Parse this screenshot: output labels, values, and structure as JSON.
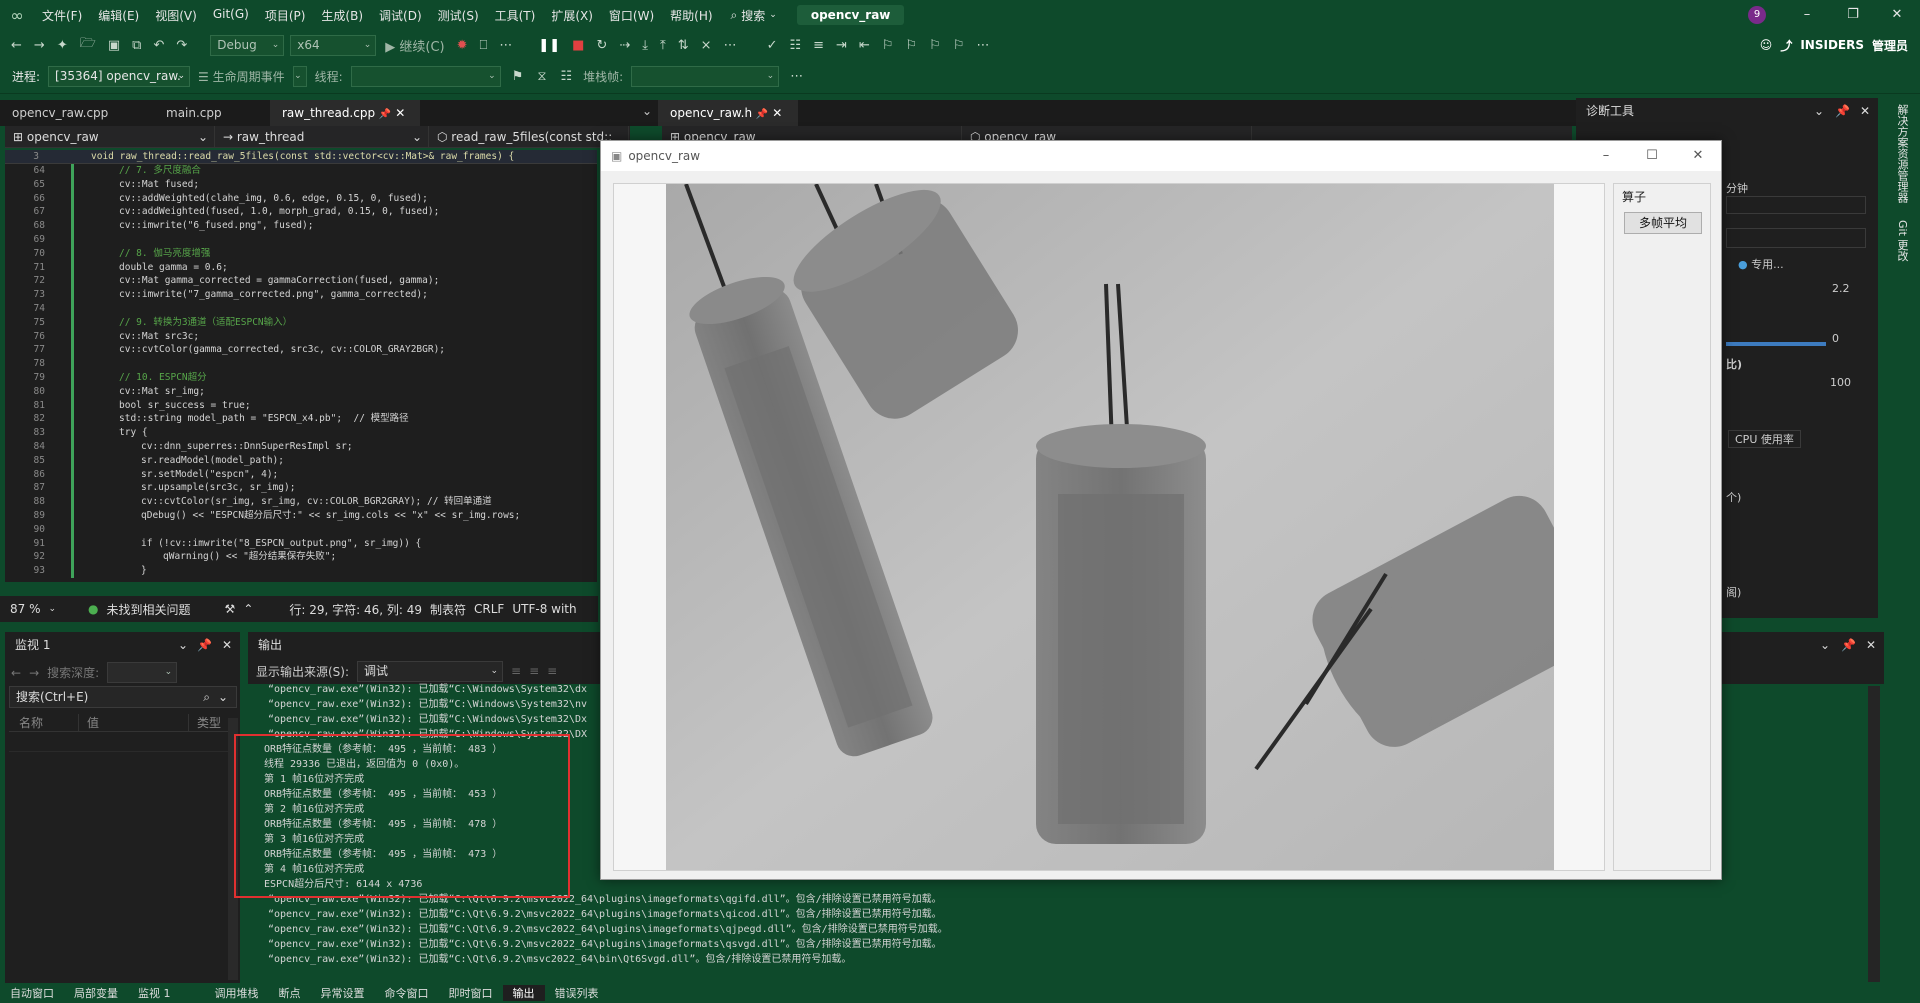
{
  "menubar": {
    "items": [
      "文件(F)",
      "编辑(E)",
      "视图(V)",
      "Git(G)",
      "项目(P)",
      "生成(B)",
      "调试(D)",
      "测试(S)",
      "工具(T)",
      "扩展(X)",
      "窗口(W)",
      "帮助(H)"
    ],
    "search_label": "搜索",
    "solution_name": "opencv_raw",
    "notification_count": "9"
  },
  "toolbar1": {
    "config": "Debug",
    "platform": "x64",
    "continue_label": "继续(C)",
    "insiders_label": "INSIDERS",
    "admin_label": "管理员"
  },
  "toolbar2": {
    "process_label": "进程:",
    "process_value": "[35364] opencv_raw.",
    "lifecycle_label": "生命周期事件",
    "thread_label": "线程:",
    "stackframe_label": "堆栈帧:"
  },
  "editor": {
    "tabs": [
      "opencv_raw.cpp",
      "main.cpp",
      "raw_thread.cpp"
    ],
    "active_tab": "raw_thread.cpp",
    "nav_project": "opencv_raw",
    "nav_scope": "raw_thread",
    "nav_member": "read_raw_5files(const std::",
    "sticky_line_number": "3",
    "sticky_line": "void raw_thread::read_raw_5files(const std::vector<cv::Mat>& raw_frames) {",
    "lines": [
      {
        "n": "64",
        "t": "// 7. 多尺度融合",
        "k": "com",
        "i": 1
      },
      {
        "n": "65",
        "t": "cv::Mat fused;",
        "k": "code",
        "i": 1
      },
      {
        "n": "66",
        "t": "cv::addWeighted(clahe_img, 0.6, edge, 0.15, 0, fused);",
        "k": "code",
        "i": 1
      },
      {
        "n": "67",
        "t": "cv::addWeighted(fused, 1.0, morph_grad, 0.15, 0, fused);",
        "k": "code",
        "i": 1
      },
      {
        "n": "68",
        "t": "cv::imwrite(\"6_fused.png\", fused);",
        "k": "code",
        "i": 1
      },
      {
        "n": "69",
        "t": "",
        "k": "code",
        "i": 1
      },
      {
        "n": "70",
        "t": "// 8. 伽马亮度增强",
        "k": "com",
        "i": 1
      },
      {
        "n": "71",
        "t": "double gamma = 0.6;",
        "k": "code",
        "i": 1
      },
      {
        "n": "72",
        "t": "cv::Mat gamma_corrected = gammaCorrection(fused, gamma);",
        "k": "code",
        "i": 1
      },
      {
        "n": "73",
        "t": "cv::imwrite(\"7_gamma_corrected.png\", gamma_corrected);",
        "k": "code",
        "i": 1
      },
      {
        "n": "74",
        "t": "",
        "k": "code",
        "i": 1
      },
      {
        "n": "75",
        "t": "// 9. 转换为3通道（适配ESPCN输入）",
        "k": "com",
        "i": 1
      },
      {
        "n": "76",
        "t": "cv::Mat src3c;",
        "k": "code",
        "i": 1
      },
      {
        "n": "77",
        "t": "cv::cvtColor(gamma_corrected, src3c, cv::COLOR_GRAY2BGR);",
        "k": "code",
        "i": 1
      },
      {
        "n": "78",
        "t": "",
        "k": "code",
        "i": 1
      },
      {
        "n": "79",
        "t": "// 10. ESPCN超分",
        "k": "com",
        "i": 1
      },
      {
        "n": "80",
        "t": "cv::Mat sr_img;",
        "k": "code",
        "i": 1
      },
      {
        "n": "81",
        "t": "bool sr_success = true;",
        "k": "code",
        "i": 1
      },
      {
        "n": "82",
        "t": "std::string model_path = \"ESPCN_x4.pb\";  // 模型路径",
        "k": "code",
        "i": 1
      },
      {
        "n": "83",
        "t": "try {",
        "k": "code",
        "i": 1
      },
      {
        "n": "84",
        "t": "cv::dnn_superres::DnnSuperResImpl sr;",
        "k": "code",
        "i": 2
      },
      {
        "n": "85",
        "t": "sr.readModel(model_path);",
        "k": "code",
        "i": 2
      },
      {
        "n": "86",
        "t": "sr.setModel(\"espcn\", 4);",
        "k": "code",
        "i": 2
      },
      {
        "n": "87",
        "t": "sr.upsample(src3c, sr_img);",
        "k": "code",
        "i": 2
      },
      {
        "n": "88",
        "t": "cv::cvtColor(sr_img, sr_img, cv::COLOR_BGR2GRAY); // 转回单通道",
        "k": "code",
        "i": 2
      },
      {
        "n": "89",
        "t": "qDebug() << \"ESPCN超分后尺寸:\" << sr_img.cols << \"x\" << sr_img.rows;",
        "k": "code",
        "i": 2
      },
      {
        "n": "90",
        "t": "",
        "k": "code",
        "i": 2
      },
      {
        "n": "91",
        "t": "if (!cv::imwrite(\"8_ESPCN_output.png\", sr_img)) {",
        "k": "code",
        "i": 2
      },
      {
        "n": "92",
        "t": "qWarning() << \"超分结果保存失败\";",
        "k": "code",
        "i": 3
      },
      {
        "n": "93",
        "t": "}",
        "k": "code",
        "i": 2
      }
    ],
    "zoom": "87 %",
    "issues": "未找到相关问题",
    "position": "行: 29, 字符: 46, 列: 49",
    "indent": "制表符",
    "eol": "CRLF",
    "encoding": "UTF-8 with"
  },
  "editor2": {
    "tab": "opencv_raw.h",
    "nav_project": "opencv_raw",
    "nav_scope": "opencv_raw"
  },
  "watch": {
    "title": "监视 1",
    "search_depth_label": "搜索深度:",
    "search_placeholder": "搜索(Ctrl+E)",
    "col_name": "名称",
    "col_value": "值",
    "col_type": "类型"
  },
  "output": {
    "title": "输出",
    "source_label": "显示输出来源(S):",
    "source_value": "调试",
    "lines": [
      "“opencv_raw.exe”(Win32): 已加载“C:\\Windows\\System32\\dx",
      "“opencv_raw.exe”(Win32): 已加载“C:\\Windows\\System32\\nv",
      "“opencv_raw.exe”(Win32): 已加载“C:\\Windows\\System32\\Dx",
      "“opencv_raw.exe”(Win32): 已加载“C:\\Windows\\System32\\DX",
      "ORB特征点数量（参考帧： 495 ，当前帧： 483 ）",
      "线程 29336 已退出，返回值为 0 (0x0)。",
      "第 1 帧16位对齐完成",
      "ORB特征点数量（参考帧： 495 ，当前帧： 453 ）",
      "第 2 帧16位对齐完成",
      "ORB特征点数量（参考帧： 495 ，当前帧： 478 ）",
      "第 3 帧16位对齐完成",
      "ORB特征点数量（参考帧： 495 ，当前帧： 473 ）",
      "第 4 帧16位对齐完成",
      "ESPCN超分后尺寸: 6144 x 4736",
      "“opencv_raw.exe”(Win32): 已加载“C:\\Qt\\6.9.2\\msvc2022_64\\plugins\\imageformats\\qgifd.dll”。包含/排除设置已禁用符号加载。",
      "“opencv_raw.exe”(Win32): 已加载“C:\\Qt\\6.9.2\\msvc2022_64\\plugins\\imageformats\\qicod.dll”。包含/排除设置已禁用符号加载。",
      "“opencv_raw.exe”(Win32): 已加载“C:\\Qt\\6.9.2\\msvc2022_64\\plugins\\imageformats\\qjpegd.dll”。包含/排除设置已禁用符号加载。",
      "“opencv_raw.exe”(Win32): 已加载“C:\\Qt\\6.9.2\\msvc2022_64\\plugins\\imageformats\\qsvgd.dll”。包含/排除设置已禁用符号加载。",
      "“opencv_raw.exe”(Win32): 已加载“C:\\Qt\\6.9.2\\msvc2022_64\\bin\\Qt6Svgd.dll”。包含/排除设置已禁用符号加载。"
    ]
  },
  "bottom_tabs": [
    "自动窗口",
    "局部变量",
    "监视 1",
    "调用堆栈",
    "断点",
    "异常设置",
    "命令窗口",
    "即时窗口",
    "输出",
    "错误列表"
  ],
  "diag": {
    "title": "诊断工具",
    "time_label": "分钟",
    "mem_max": "2.2",
    "mem_min": "0",
    "private_label": "专用...",
    "ratio_label": "比)",
    "cpu_max": "100",
    "cpu_tab": "CPU 使用率",
    "frag1": "个)",
    "frag2": "阁)"
  },
  "right_strip": [
    "解决方案资源管理器",
    "Git 更改"
  ],
  "qt_window": {
    "title": "opencv_raw",
    "group_title": "算子",
    "button_label": "多帧平均"
  },
  "colors": {
    "accent_green": "#0e4a2b",
    "highlight_red": "#e03030",
    "code_bg": "#1e1e1e"
  }
}
